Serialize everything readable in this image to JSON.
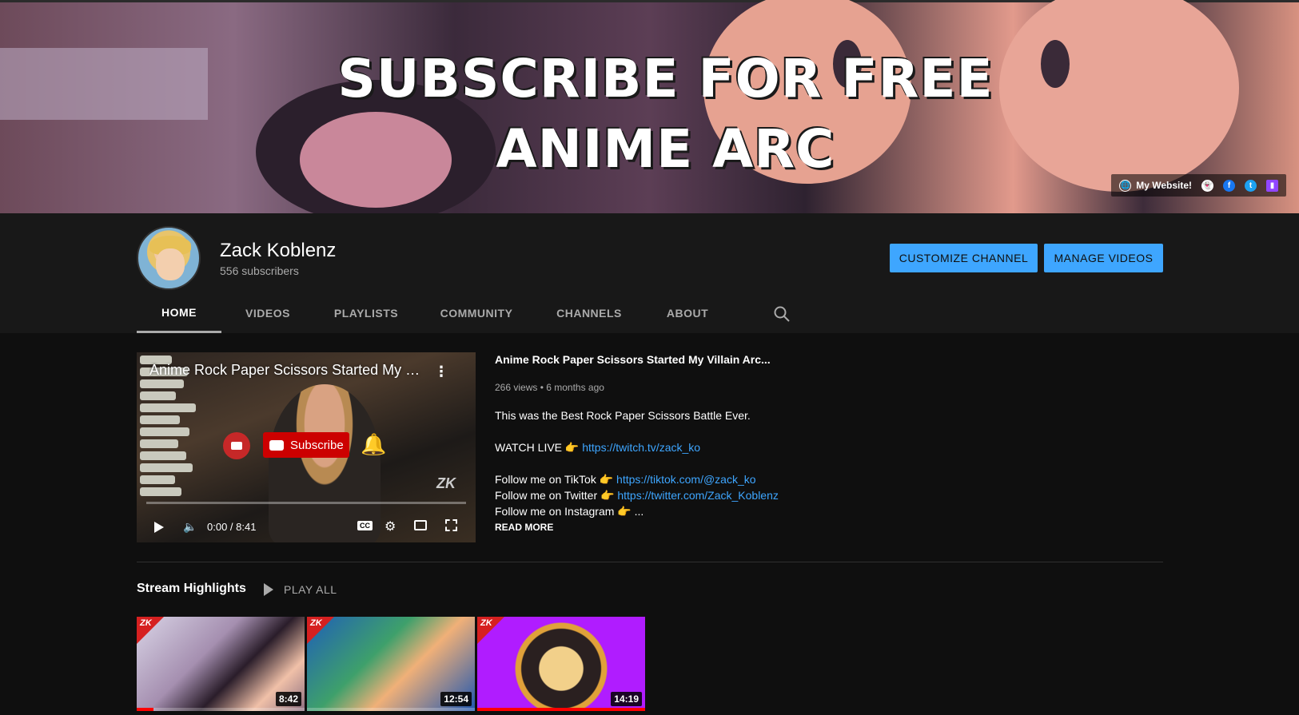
{
  "banner": {
    "line1": "SUBSCRIBE FOR FREE",
    "line2": "ANIME ARC",
    "website_label": "My Website!",
    "social_icons": [
      "snapchat-icon",
      "facebook-icon",
      "twitter-icon",
      "twitch-icon"
    ]
  },
  "channel": {
    "name": "Zack Koblenz",
    "subscribers": "556 subscribers",
    "customize_label": "CUSTOMIZE CHANNEL",
    "manage_label": "MANAGE VIDEOS"
  },
  "tabs": [
    {
      "label": "HOME",
      "active": true
    },
    {
      "label": "VIDEOS",
      "active": false
    },
    {
      "label": "PLAYLISTS",
      "active": false
    },
    {
      "label": "COMMUNITY",
      "active": false
    },
    {
      "label": "CHANNELS",
      "active": false
    },
    {
      "label": "ABOUT",
      "active": false
    }
  ],
  "featured": {
    "player_title": "Anime Rock Paper Scissors Started My Vi...",
    "subscribe_label": "Subscribe",
    "watermark": "ZK",
    "time": "0:00 / 8:41",
    "cc_label": "CC",
    "title": "Anime Rock Paper Scissors Started My Villain Arc...",
    "meta": "266 views • 6 months ago",
    "desc": {
      "line1": "This was the Best Rock Paper Scissors Battle Ever.",
      "watch_live": "WATCH LIVE 👉",
      "watch_live_link": "https://twitch.tv/zack_ko",
      "tiktok": "Follow me on TikTok 👉",
      "tiktok_link": "https://tiktok.com/@zack_ko",
      "twitter": "Follow me on Twitter 👉",
      "twitter_link": "https://twitter.com/Zack_Koblenz",
      "instagram": "Follow me on Instagram 👉 ..."
    },
    "read_more": "READ MORE"
  },
  "shelf": {
    "title": "Stream Highlights",
    "play_all": "PLAY ALL",
    "videos": [
      {
        "duration": "8:42",
        "progress": 0.1
      },
      {
        "duration": "12:54",
        "progress": 0.0
      },
      {
        "duration": "14:19",
        "progress": 1.0
      }
    ]
  },
  "colors": {
    "accent": "#3ea6ff",
    "background": "#0f0f0f",
    "header": "#181818",
    "youtube_red": "#cc0000"
  }
}
